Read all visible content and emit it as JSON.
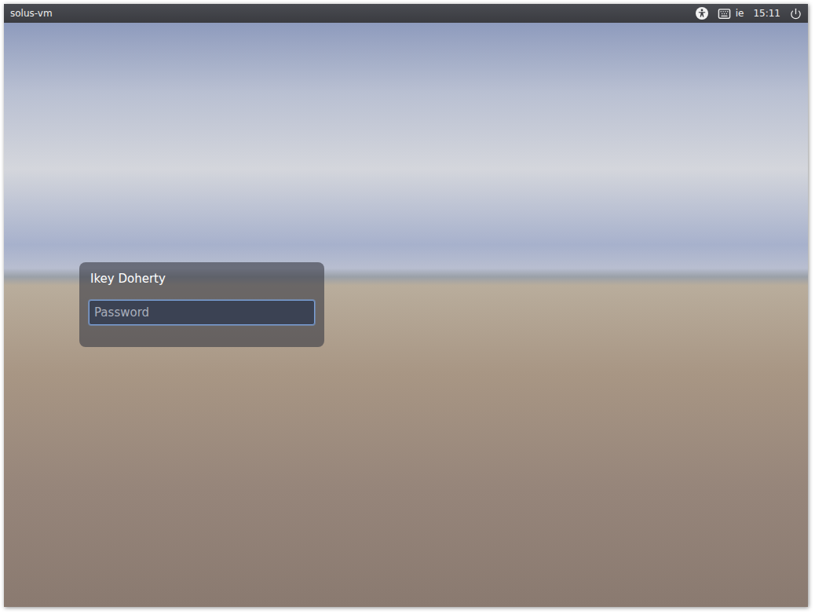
{
  "top_bar": {
    "hostname": "solus-vm",
    "keyboard_layout": "ie",
    "clock": "15:11"
  },
  "login": {
    "user_name": "Ikey Doherty",
    "password": {
      "placeholder": "Password",
      "focused": true
    }
  }
}
